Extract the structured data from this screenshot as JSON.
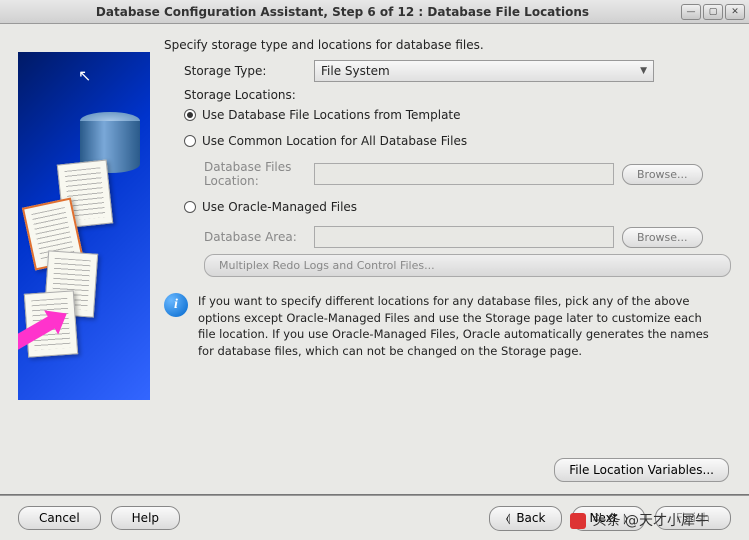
{
  "titlebar": {
    "title": "Database Configuration Assistant, Step 6 of 12 : Database File Locations"
  },
  "main": {
    "instruction": "Specify storage type and locations for database files.",
    "storage_type_label": "Storage Type:",
    "storage_type_value": "File System",
    "storage_locations_label": "Storage Locations:",
    "radio1": "Use Database File Locations from Template",
    "radio2": "Use Common Location for All Database Files",
    "db_files_location_label": "Database Files Location:",
    "radio3": "Use Oracle-Managed Files",
    "db_area_label": "Database Area:",
    "browse_label": "Browse...",
    "multiplex_label": "Multiplex Redo Logs and Control Files...",
    "info_text": "If you want to specify different locations for any database files, pick any of the above options except Oracle-Managed Files and use the Storage page later to customize each file location. If you use Oracle-Managed Files, Oracle automatically generates the names for database files, which can not be changed on the Storage page.",
    "flv_label": "File Location Variables..."
  },
  "footer": {
    "cancel": "Cancel",
    "help": "Help",
    "back": "Back",
    "next": "Next",
    "finish": "Finish"
  },
  "watermark": "头条 @天才小犀牛"
}
